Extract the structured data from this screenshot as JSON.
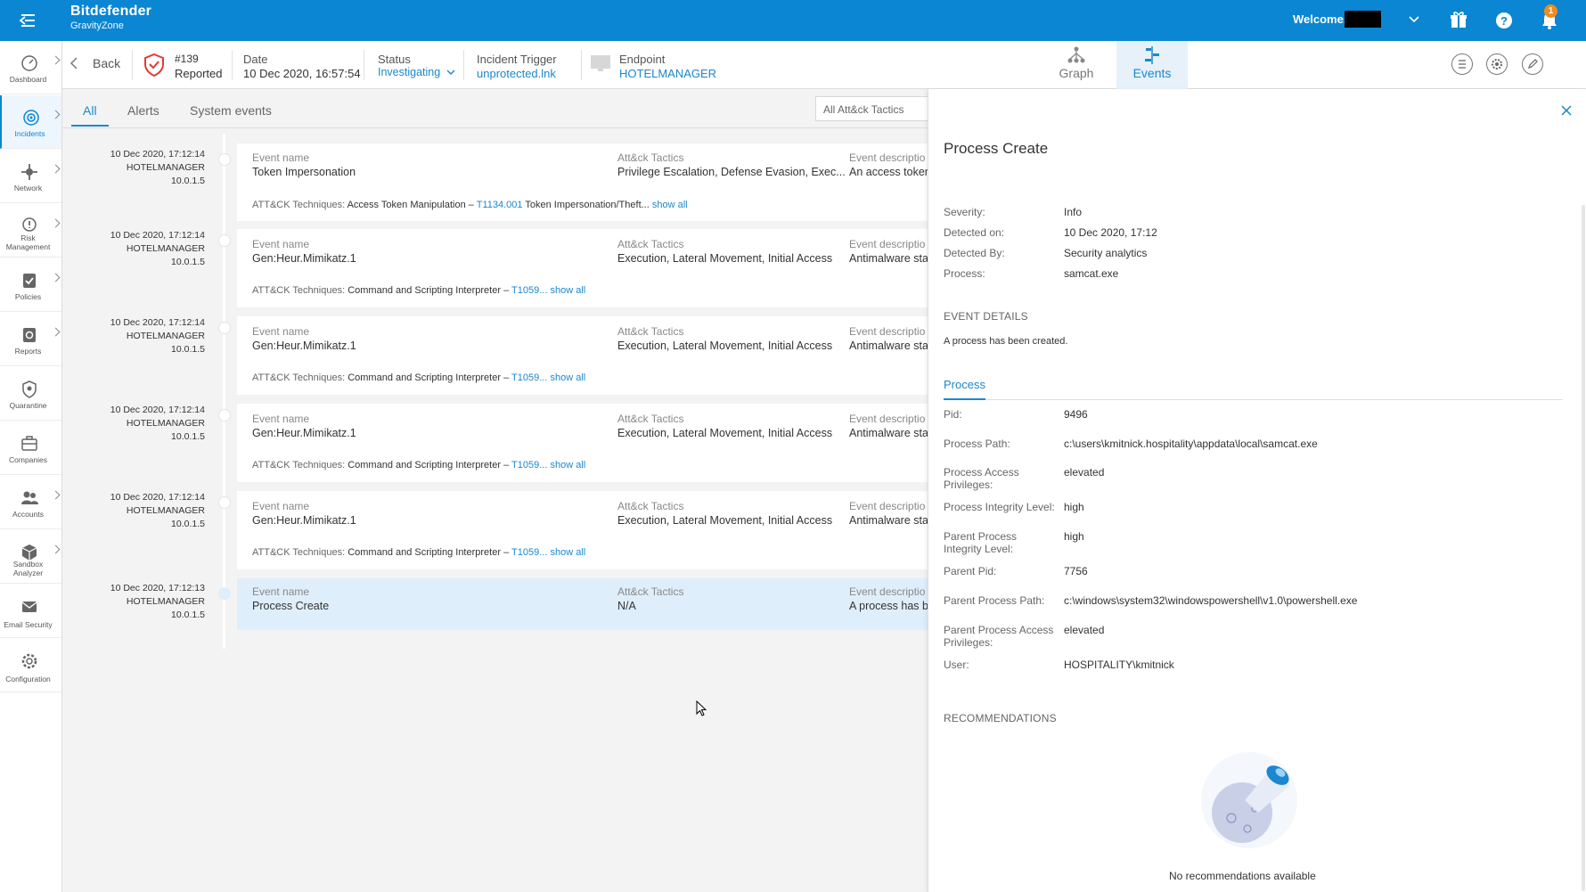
{
  "topbar": {
    "brand_name": "Bitdefender",
    "brand_sub": "GravityZone",
    "welcome": "Welcome,",
    "notification_count": "1"
  },
  "sidenav": {
    "items": [
      {
        "label": "Dashboard"
      },
      {
        "label": "Incidents"
      },
      {
        "label": "Network"
      },
      {
        "label": "Risk Management"
      },
      {
        "label": "Policies"
      },
      {
        "label": "Reports"
      },
      {
        "label": "Quarantine"
      },
      {
        "label": "Companies"
      },
      {
        "label": "Accounts"
      },
      {
        "label": "Sandbox Analyzer"
      },
      {
        "label": "Email Security"
      },
      {
        "label": "Configuration"
      }
    ]
  },
  "header": {
    "back": "Back",
    "incident_id": "#139",
    "incident_state": "Reported",
    "date_label": "Date",
    "date_value": "10 Dec 2020, 16:57:54",
    "status_label": "Status",
    "status_value": "Investigating",
    "trigger_label": "Incident Trigger",
    "trigger_value": "unprotected.lnk",
    "endpoint_label": "Endpoint",
    "endpoint_value": "HOTELMANAGER",
    "view_graph": "Graph",
    "view_events": "Events"
  },
  "filters": {
    "tabs": [
      "All",
      "Alerts",
      "System events"
    ],
    "tactics_select": "All Att&ck Tactics"
  },
  "labels": {
    "event_name": "Event name",
    "tactics": "Att&ck Tactics",
    "description": "Event descriptio",
    "techniques": "ATT&CK Techniques:",
    "show_all": "show all"
  },
  "events": [
    {
      "date": "10 Dec 2020, 17:12:14",
      "host": "HOTELMANAGER",
      "ip": "10.0.1.5",
      "name": "Token Impersonation",
      "tactics": "Privilege Escalation, Defense Evasion, Exec...",
      "description": "An access toker",
      "tech_a": "Access Token Manipulation –",
      "tech_id": "T1134.001",
      "tech_b": "Token Impersonation/Theft..."
    },
    {
      "date": "10 Dec 2020, 17:12:14",
      "host": "HOTELMANAGER",
      "ip": "10.0.1.5",
      "name": "Gen:Heur.Mimikatz.1",
      "tactics": "Execution, Lateral Movement, Initial Access",
      "description": "Antimalware sta",
      "tech_a": "Command and Scripting Interpreter –",
      "tech_id": "T1059...",
      "tech_b": ""
    },
    {
      "date": "10 Dec 2020, 17:12:14",
      "host": "HOTELMANAGER",
      "ip": "10.0.1.5",
      "name": "Gen:Heur.Mimikatz.1",
      "tactics": "Execution, Lateral Movement, Initial Access",
      "description": "Antimalware sta",
      "tech_a": "Command and Scripting Interpreter –",
      "tech_id": "T1059...",
      "tech_b": ""
    },
    {
      "date": "10 Dec 2020, 17:12:14",
      "host": "HOTELMANAGER",
      "ip": "10.0.1.5",
      "name": "Gen:Heur.Mimikatz.1",
      "tactics": "Execution, Lateral Movement, Initial Access",
      "description": "Antimalware sta",
      "tech_a": "Command and Scripting Interpreter –",
      "tech_id": "T1059...",
      "tech_b": ""
    },
    {
      "date": "10 Dec 2020, 17:12:14",
      "host": "HOTELMANAGER",
      "ip": "10.0.1.5",
      "name": "Gen:Heur.Mimikatz.1",
      "tactics": "Execution, Lateral Movement, Initial Access",
      "description": "Antimalware sta",
      "tech_a": "Command and Scripting Interpreter –",
      "tech_id": "T1059...",
      "tech_b": ""
    },
    {
      "date": "10 Dec 2020, 17:12:13",
      "host": "HOTELMANAGER",
      "ip": "10.0.1.5",
      "name": "Process Create",
      "tactics": "N/A",
      "description": "A process has b"
    }
  ],
  "details": {
    "title": "Process Create",
    "summary": [
      {
        "key": "Severity:",
        "value": "Info"
      },
      {
        "key": "Detected on:",
        "value": "10 Dec 2020, 17:12"
      },
      {
        "key": "Detected By:",
        "value": "Security analytics"
      },
      {
        "key": "Process:",
        "value": "samcat.exe"
      }
    ],
    "event_details_heading": "EVENT DETAILS",
    "event_details_text": "A process has been created.",
    "process_tab": "Process",
    "process": [
      {
        "key": "Pid:",
        "value": "9496"
      },
      {
        "key": "Process Path:",
        "value": "c:\\users\\kmitnick.hospitality\\appdata\\local\\samcat.exe"
      },
      {
        "key": "Process Access Privileges:",
        "value": "elevated"
      },
      {
        "key": "Process Integrity Level:",
        "value": "high"
      },
      {
        "key": "Parent Process Integrity Level:",
        "value": "high"
      },
      {
        "key": "Parent Pid:",
        "value": "7756"
      },
      {
        "key": "Parent Process Path:",
        "value": "c:\\windows\\system32\\windowspowershell\\v1.0\\powershell.exe"
      },
      {
        "key": "Parent Process Access Privileges:",
        "value": "elevated"
      },
      {
        "key": "User:",
        "value": "HOSPITALITY\\kmitnick"
      }
    ],
    "recommendations_heading": "RECOMMENDATIONS",
    "no_recommendations": "No recommendations available"
  },
  "colors": {
    "brand": "#0a86d3",
    "link": "#1b87cf",
    "selected_row": "#dfeefb",
    "badge": "#f38b1a"
  }
}
